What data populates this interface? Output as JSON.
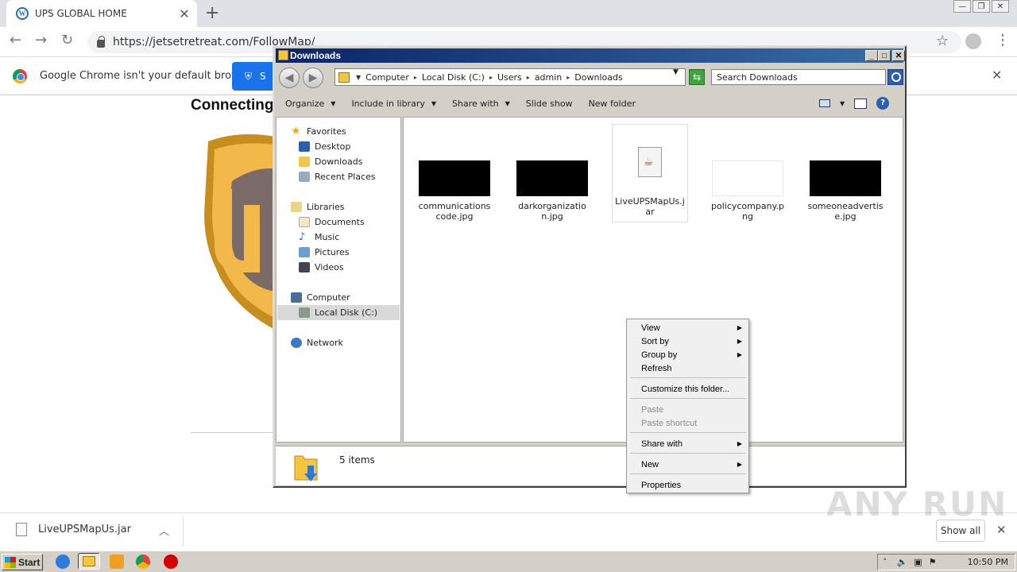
{
  "browser": {
    "tab_title": "UPS GLOBAL HOME",
    "url": "https://jetsetretreat.com/FollowMap/",
    "infobar_message": "Google Chrome isn't your default browser",
    "infobar_button": "S",
    "page_heading": "Connecting",
    "download_file": "LiveUPSMapUs.jar",
    "show_all": "Show all"
  },
  "explorer": {
    "title": "Downloads",
    "breadcrumbs": [
      "Computer",
      "Local Disk (C:)",
      "Users",
      "admin",
      "Downloads"
    ],
    "search_placeholder": "Search Downloads",
    "commands": [
      "Organize",
      "Include in library",
      "Share with",
      "Slide show",
      "New folder"
    ],
    "nav": {
      "favorites": "Favorites",
      "desktop": "Desktop",
      "downloads": "Downloads",
      "recent": "Recent Places",
      "libraries": "Libraries",
      "documents": "Documents",
      "music": "Music",
      "pictures": "Pictures",
      "videos": "Videos",
      "computer": "Computer",
      "local_disk": "Local Disk (C:)",
      "network": "Network"
    },
    "files": [
      {
        "name": "communicationscode.jpg"
      },
      {
        "name": "darkorganization.jpg"
      },
      {
        "name": "LiveUPSMapUs.jar"
      },
      {
        "name": "policycompany.png"
      },
      {
        "name": "someoneadvertise.jpg"
      }
    ],
    "status": "5 items"
  },
  "context_menu": {
    "view": "View",
    "sort_by": "Sort by",
    "group_by": "Group by",
    "refresh": "Refresh",
    "customize": "Customize this folder...",
    "paste": "Paste",
    "paste_shortcut": "Paste shortcut",
    "share_with": "Share with",
    "new": "New",
    "properties": "Properties"
  },
  "taskbar": {
    "start": "Start",
    "clock": "10:50 PM"
  },
  "watermark": "ANY RUN"
}
